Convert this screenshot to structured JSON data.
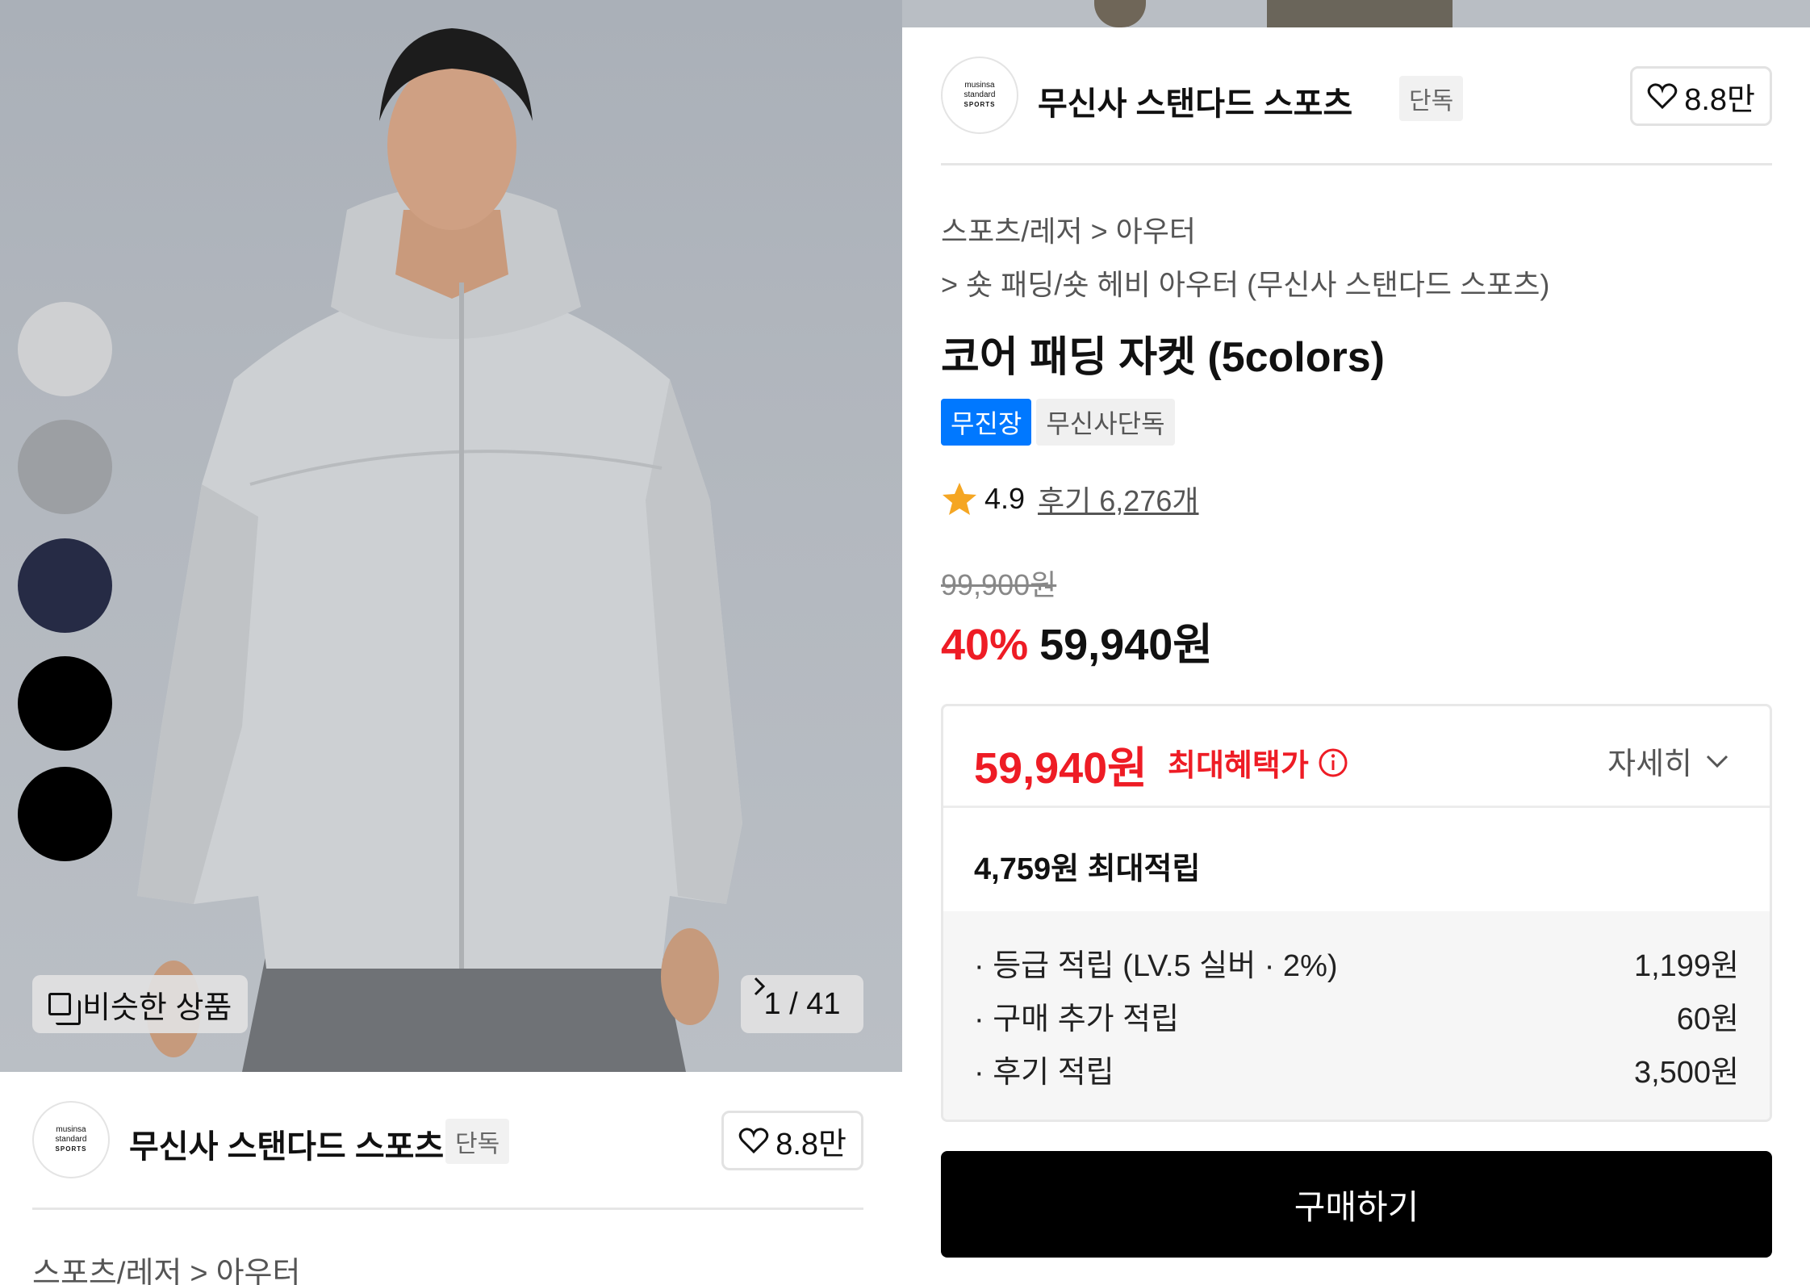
{
  "brand": {
    "name": "무신사 스탠다드 스포츠",
    "exclusive_tag": "단독",
    "likes": "8.8만",
    "logo_text": [
      "musinsa",
      "standard",
      "SPORTS"
    ]
  },
  "gallery": {
    "similar_label": "비슷한 상품",
    "counter": "1 / 41",
    "swatch_colors": [
      "#cfd0d2",
      "#9c9fa3",
      "#262b45",
      "#000000",
      "#000000"
    ]
  },
  "breadcrumb": {
    "level1": "스포츠/레저",
    "level2": "아우터",
    "level3": "숏 패딩/숏 헤비 아우터 (무신사 스탠다드 스포츠)"
  },
  "product": {
    "title": "코어 패딩 자켓 (5colors)",
    "badges": [
      "무진장",
      "무신사단독"
    ],
    "rating": "4.9",
    "reviews": "후기 6,276개",
    "original_price": "99,900원",
    "discount_percent": "40%",
    "sale_price": "59,940원"
  },
  "benefit": {
    "max_price": "59,940원",
    "max_price_label": "최대혜택가",
    "detail_label": "자세히",
    "max_points": "4,759원 최대적립",
    "point_rows": [
      {
        "label": "· 등급 적립 (LV.5 실버 · 2%)",
        "value": "1,199원"
      },
      {
        "label": "· 구매 추가 적립",
        "value": "60원"
      },
      {
        "label": "· 후기 적립",
        "value": "3,500원"
      }
    ]
  },
  "buy_button": "구매하기",
  "colors": {
    "accent_red": "#ee1c25",
    "badge_blue": "#0078ff",
    "star": "#f5a623"
  }
}
